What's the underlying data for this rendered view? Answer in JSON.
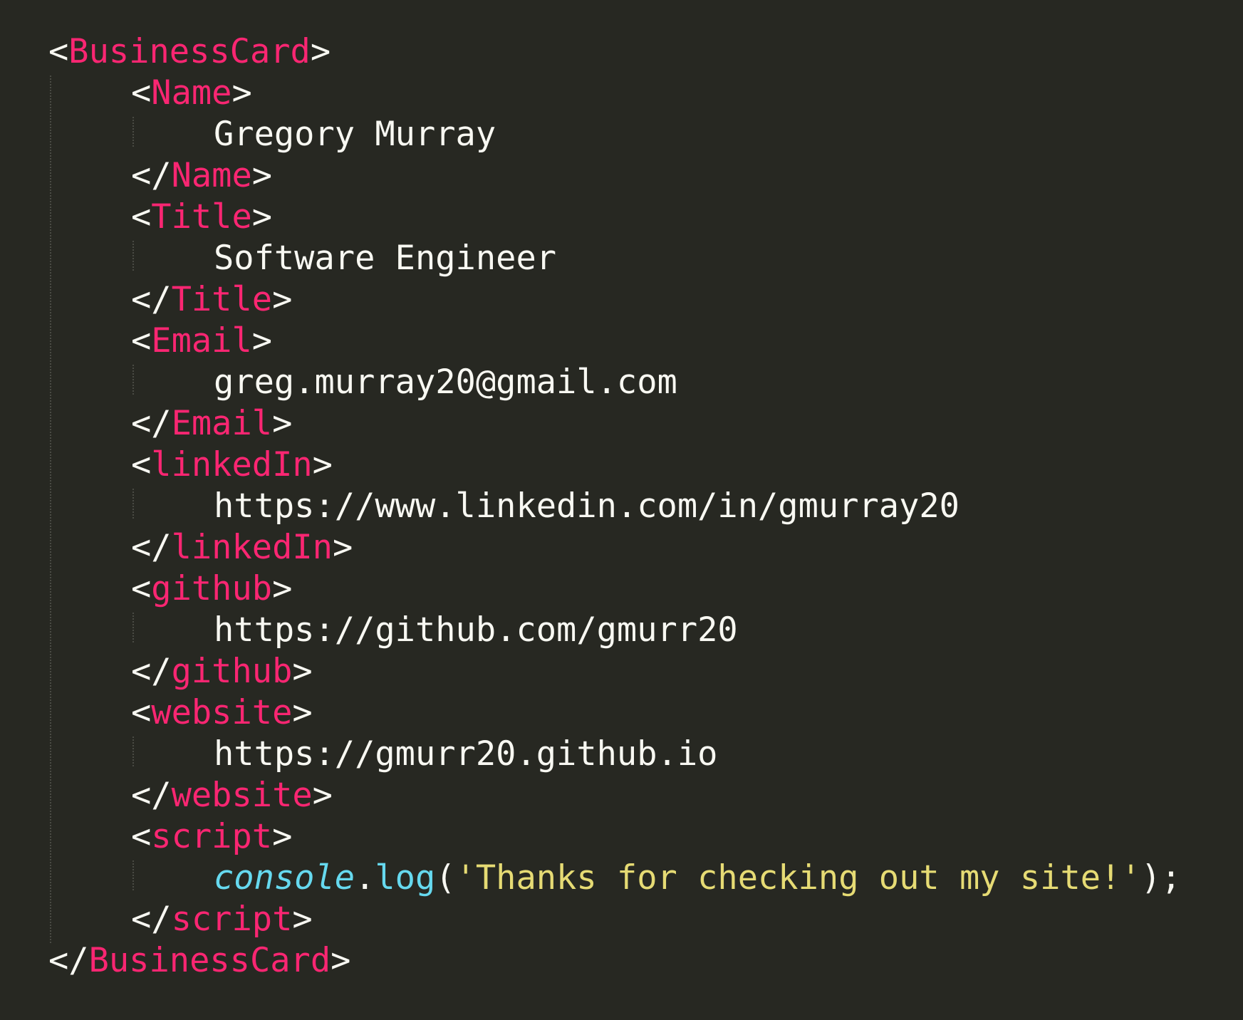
{
  "code": {
    "root_tag": "BusinessCard",
    "fields": [
      {
        "tag": "Name",
        "value": "Gregory Murray"
      },
      {
        "tag": "Title",
        "value": "Software Engineer"
      },
      {
        "tag": "Email",
        "value": "greg.murray20@gmail.com"
      },
      {
        "tag": "linkedIn",
        "value": "https://www.linkedin.com/in/gmurray20"
      },
      {
        "tag": "github",
        "value": "https://github.com/gmurr20"
      },
      {
        "tag": "website",
        "value": "https://gmurr20.github.io"
      }
    ],
    "script": {
      "tag": "script",
      "object": "console",
      "dot": ".",
      "method": "log",
      "open_paren": "(",
      "string": "'Thanks for checking out my site!'",
      "close": ");"
    },
    "symbols": {
      "lt": "<",
      "gt": ">",
      "lt_slash": "</"
    }
  },
  "colors": {
    "background": "#272822",
    "tag": "#f92672",
    "text": "#f8f8f2",
    "function": "#66d9ef",
    "string": "#e6db74",
    "indent_guide": "#4a4b44"
  }
}
